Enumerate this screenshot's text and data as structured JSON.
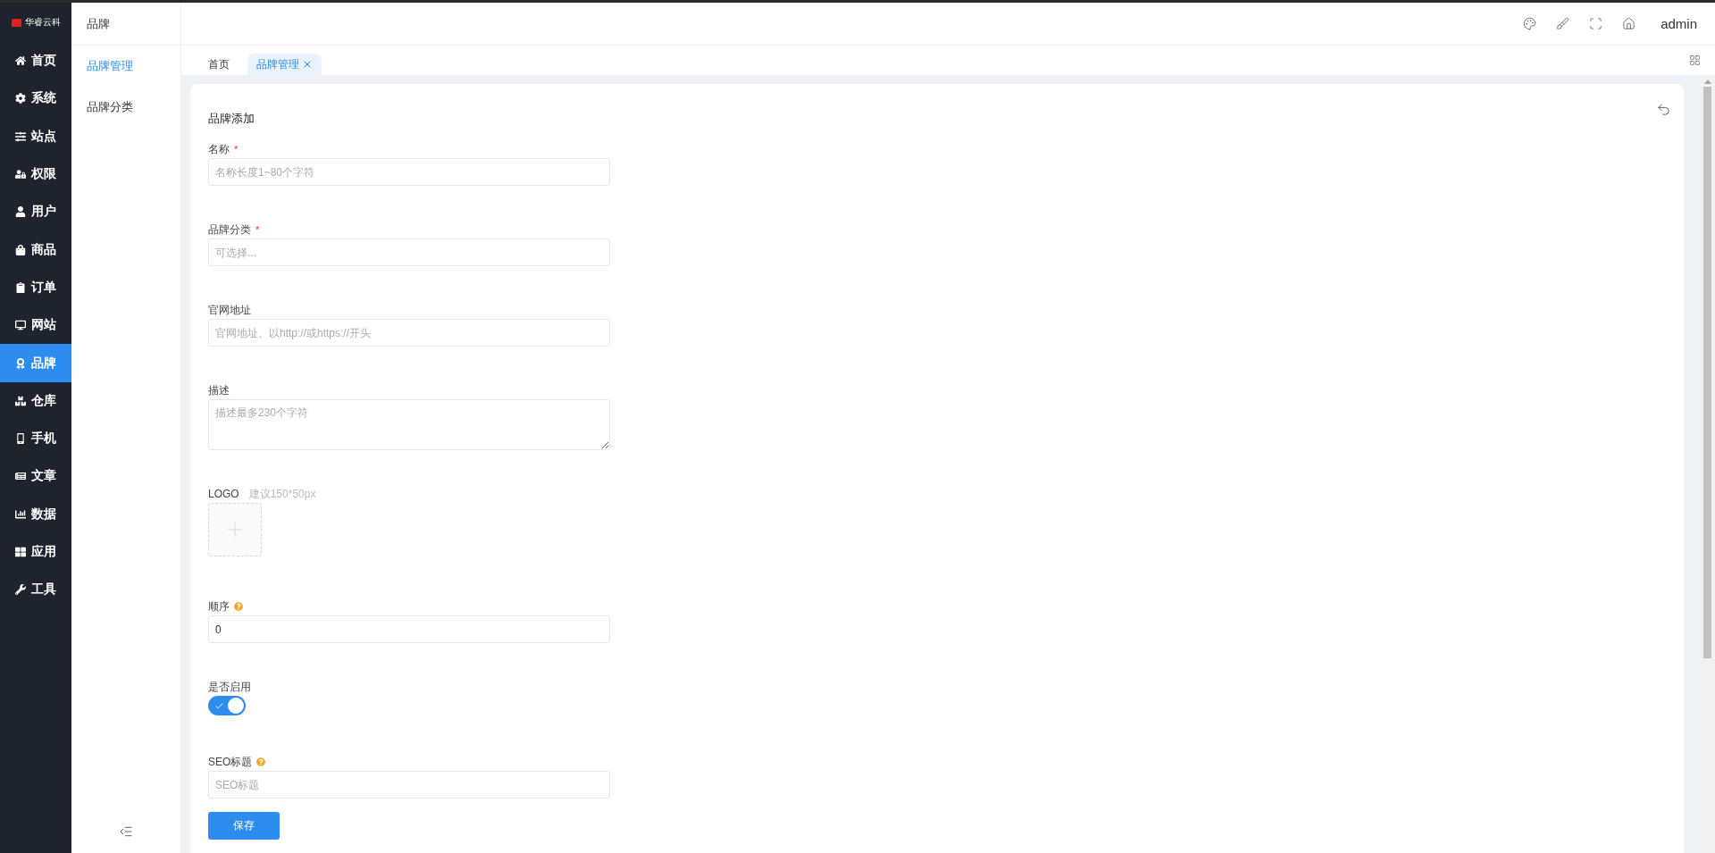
{
  "brand": {
    "name": "华睿云科"
  },
  "sidebar": {
    "items": [
      {
        "label": "首页",
        "selected": false
      },
      {
        "label": "系统",
        "selected": false
      },
      {
        "label": "站点",
        "selected": false
      },
      {
        "label": "权限",
        "selected": false
      },
      {
        "label": "用户",
        "selected": false
      },
      {
        "label": "商品",
        "selected": false
      },
      {
        "label": "订单",
        "selected": false
      },
      {
        "label": "网站",
        "selected": false
      },
      {
        "label": "品牌",
        "selected": true
      },
      {
        "label": "仓库",
        "selected": false
      },
      {
        "label": "手机",
        "selected": false
      },
      {
        "label": "文章",
        "selected": false
      },
      {
        "label": "数据",
        "selected": false
      },
      {
        "label": "应用",
        "selected": false
      },
      {
        "label": "工具",
        "selected": false
      }
    ]
  },
  "submenu": {
    "title": "品牌",
    "items": [
      {
        "label": "品牌管理",
        "selected": true
      },
      {
        "label": "品牌分类",
        "selected": false
      }
    ]
  },
  "header": {
    "user": "admin"
  },
  "tabs": [
    {
      "label": "首页",
      "selected": false,
      "closable": false
    },
    {
      "label": "品牌管理",
      "selected": true,
      "closable": true
    }
  ],
  "form": {
    "title": "品牌添加",
    "fields": [
      {
        "kind": "input",
        "label": "名称",
        "required_mark": "*",
        "placeholder": "名称长度1~80个字符"
      },
      {
        "kind": "input",
        "label": "品牌分类",
        "required_mark": "*",
        "placeholder": "可选择..."
      },
      {
        "kind": "input",
        "label": "官网地址",
        "placeholder": "官网地址、以http://或https://开头"
      },
      {
        "kind": "textarea",
        "label": "描述",
        "placeholder": "描述最多230个字符"
      },
      {
        "kind": "upload",
        "label": "LOGO",
        "hint": "建议150*50px"
      },
      {
        "kind": "input",
        "label": "顺序",
        "help": true,
        "value": "0"
      },
      {
        "kind": "switch",
        "label": "是否启用",
        "on": true
      },
      {
        "kind": "input",
        "label": "SEO标题",
        "help": true,
        "placeholder": "SEO标题"
      }
    ],
    "submit": "保存"
  }
}
